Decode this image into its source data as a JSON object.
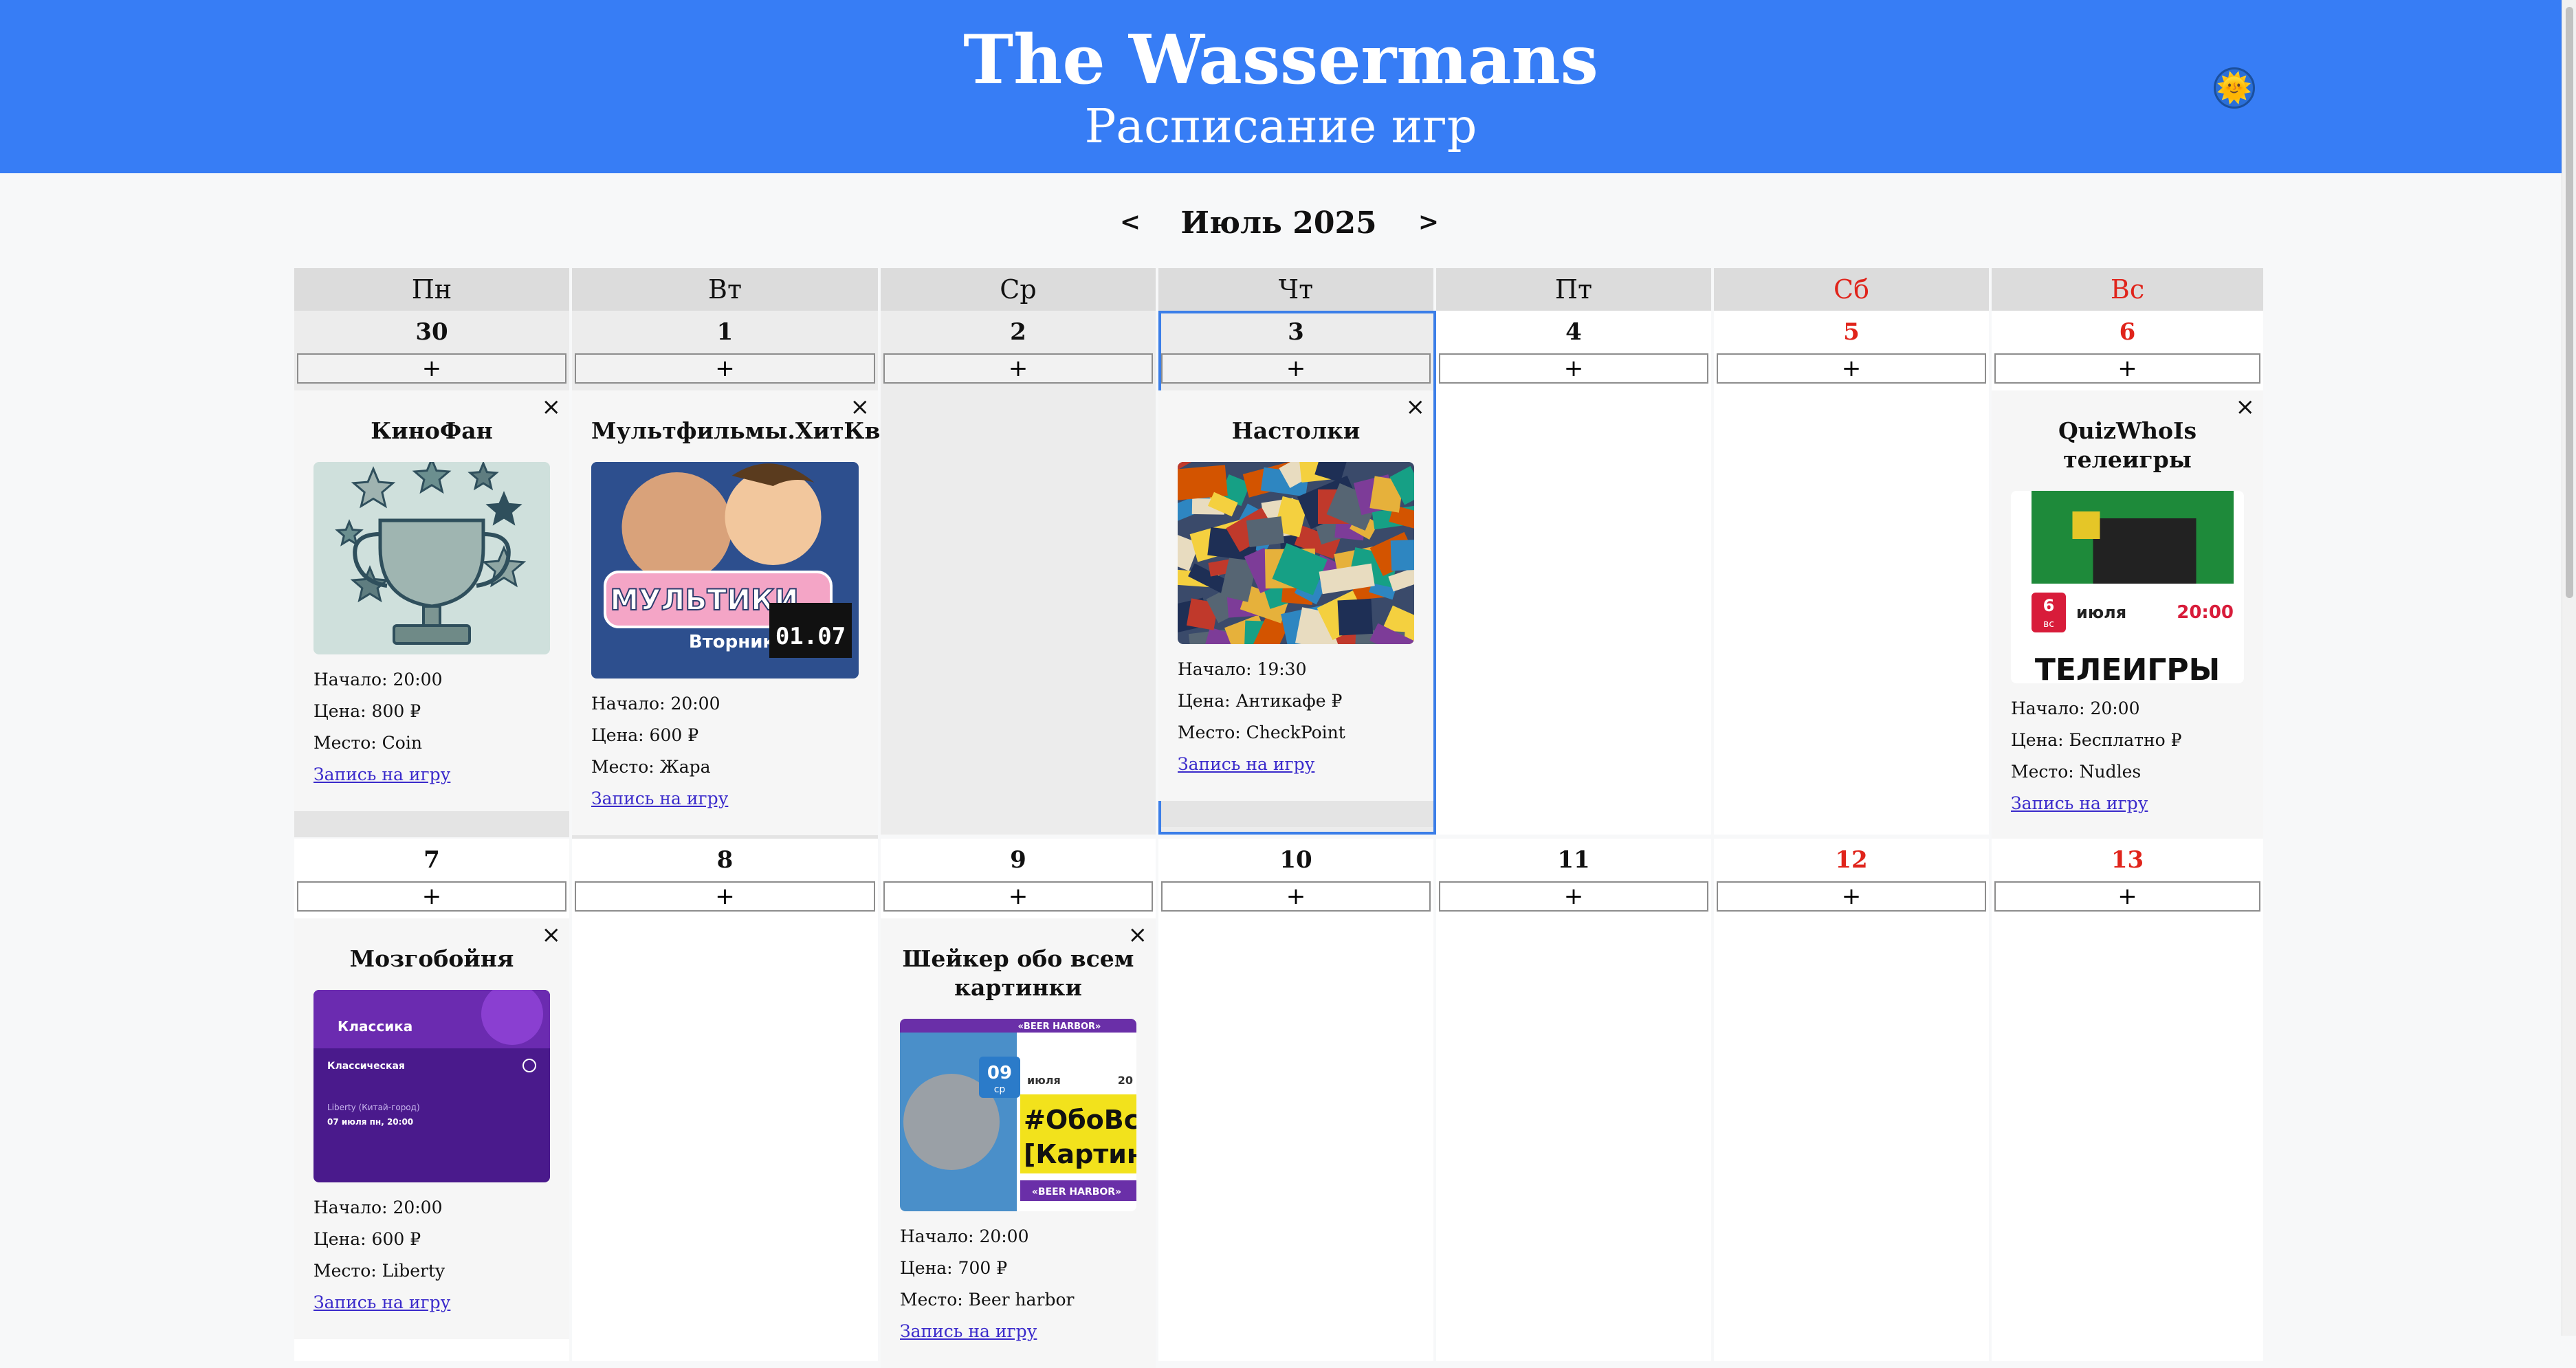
{
  "header": {
    "title": "The Wassermans",
    "subtitle": "Расписание игр"
  },
  "theme_toggle": {
    "icon": "sun-icon",
    "glyph": "🌞"
  },
  "nav": {
    "prev": "<",
    "next": ">",
    "month": "Июль 2025"
  },
  "weekdays": [
    {
      "label": "Пн",
      "weekend": false
    },
    {
      "label": "Вт",
      "weekend": false
    },
    {
      "label": "Ср",
      "weekend": false
    },
    {
      "label": "Чт",
      "weekend": false
    },
    {
      "label": "Пт",
      "weekend": false
    },
    {
      "label": "Сб",
      "weekend": true
    },
    {
      "label": "Вс",
      "weekend": true
    }
  ],
  "add_label": "+",
  "close_label": "×",
  "labels": {
    "start": "Начало: ",
    "price": "Цена: ",
    "place": "Место: ",
    "signup": "Запись на игру"
  },
  "weeks": [
    [
      {
        "day": "30",
        "other": true,
        "weekend": false,
        "event": {
          "name": "КиноФан",
          "start": "20:00",
          "price": "800 ₽",
          "place": "Coin",
          "image": "trophy"
        }
      },
      {
        "day": "1",
        "other": true,
        "weekend": false,
        "event": {
          "name": "Мультфильмы.ХитКвиз",
          "start": "20:00",
          "price": "600 ₽",
          "place": "Жара",
          "image": "cartoon",
          "image_text": "МУЛЬТИКИ",
          "image_sub": "Вторник",
          "image_date": "01.07"
        }
      },
      {
        "day": "2",
        "other": true,
        "weekend": false,
        "event": null
      },
      {
        "day": "3",
        "other": true,
        "weekend": false,
        "today": true,
        "event": {
          "name": "Настолки",
          "start": "19:30",
          "price": "Антикафе ₽",
          "place": "CheckPoint",
          "image": "boardgames"
        }
      },
      {
        "day": "4",
        "other": false,
        "weekend": false,
        "event": null
      },
      {
        "day": "5",
        "other": false,
        "weekend": true,
        "event": null
      },
      {
        "day": "6",
        "other": false,
        "weekend": true,
        "event": {
          "name": "QuizWhoIs телеигры",
          "start": "20:00",
          "price": "Бесплатно ₽",
          "place": "Nudles",
          "image": "teleigry",
          "image_day": "6",
          "image_dow": "вс",
          "image_month": "июля",
          "image_time": "20:00",
          "image_text": "ТЕЛЕИГРЫ"
        }
      }
    ],
    [
      {
        "day": "7",
        "other": false,
        "weekend": false,
        "event": {
          "name": "Мозгобойня",
          "start": "20:00",
          "price": "600 ₽",
          "place": "Liberty",
          "image": "mozgo",
          "image_title": "Классика",
          "image_sub": "Классическая",
          "image_place": "Liberty (Китай-город)",
          "image_date": "07 июля пн, 20:00"
        }
      },
      {
        "day": "8",
        "other": false,
        "weekend": false,
        "event": null
      },
      {
        "day": "9",
        "other": false,
        "weekend": false,
        "event": {
          "name": "Шейкер обо всем картинки",
          "start": "20:00",
          "price": "700 ₽",
          "place": "Beer harbor",
          "image": "shaker",
          "image_top": "«BEER HARBOR»",
          "image_day": "09",
          "image_dow": "ср",
          "image_month": "июля",
          "image_year": "20",
          "image_text1": "#ОбоВсё",
          "image_text2": "[Картинк",
          "image_bottom": "«BEER HARBOR»"
        }
      },
      {
        "day": "10",
        "other": false,
        "weekend": false,
        "event": null
      },
      {
        "day": "11",
        "other": false,
        "weekend": false,
        "event": null
      },
      {
        "day": "12",
        "other": false,
        "weekend": true,
        "event": null
      },
      {
        "day": "13",
        "other": false,
        "weekend": true,
        "event": null
      }
    ]
  ]
}
